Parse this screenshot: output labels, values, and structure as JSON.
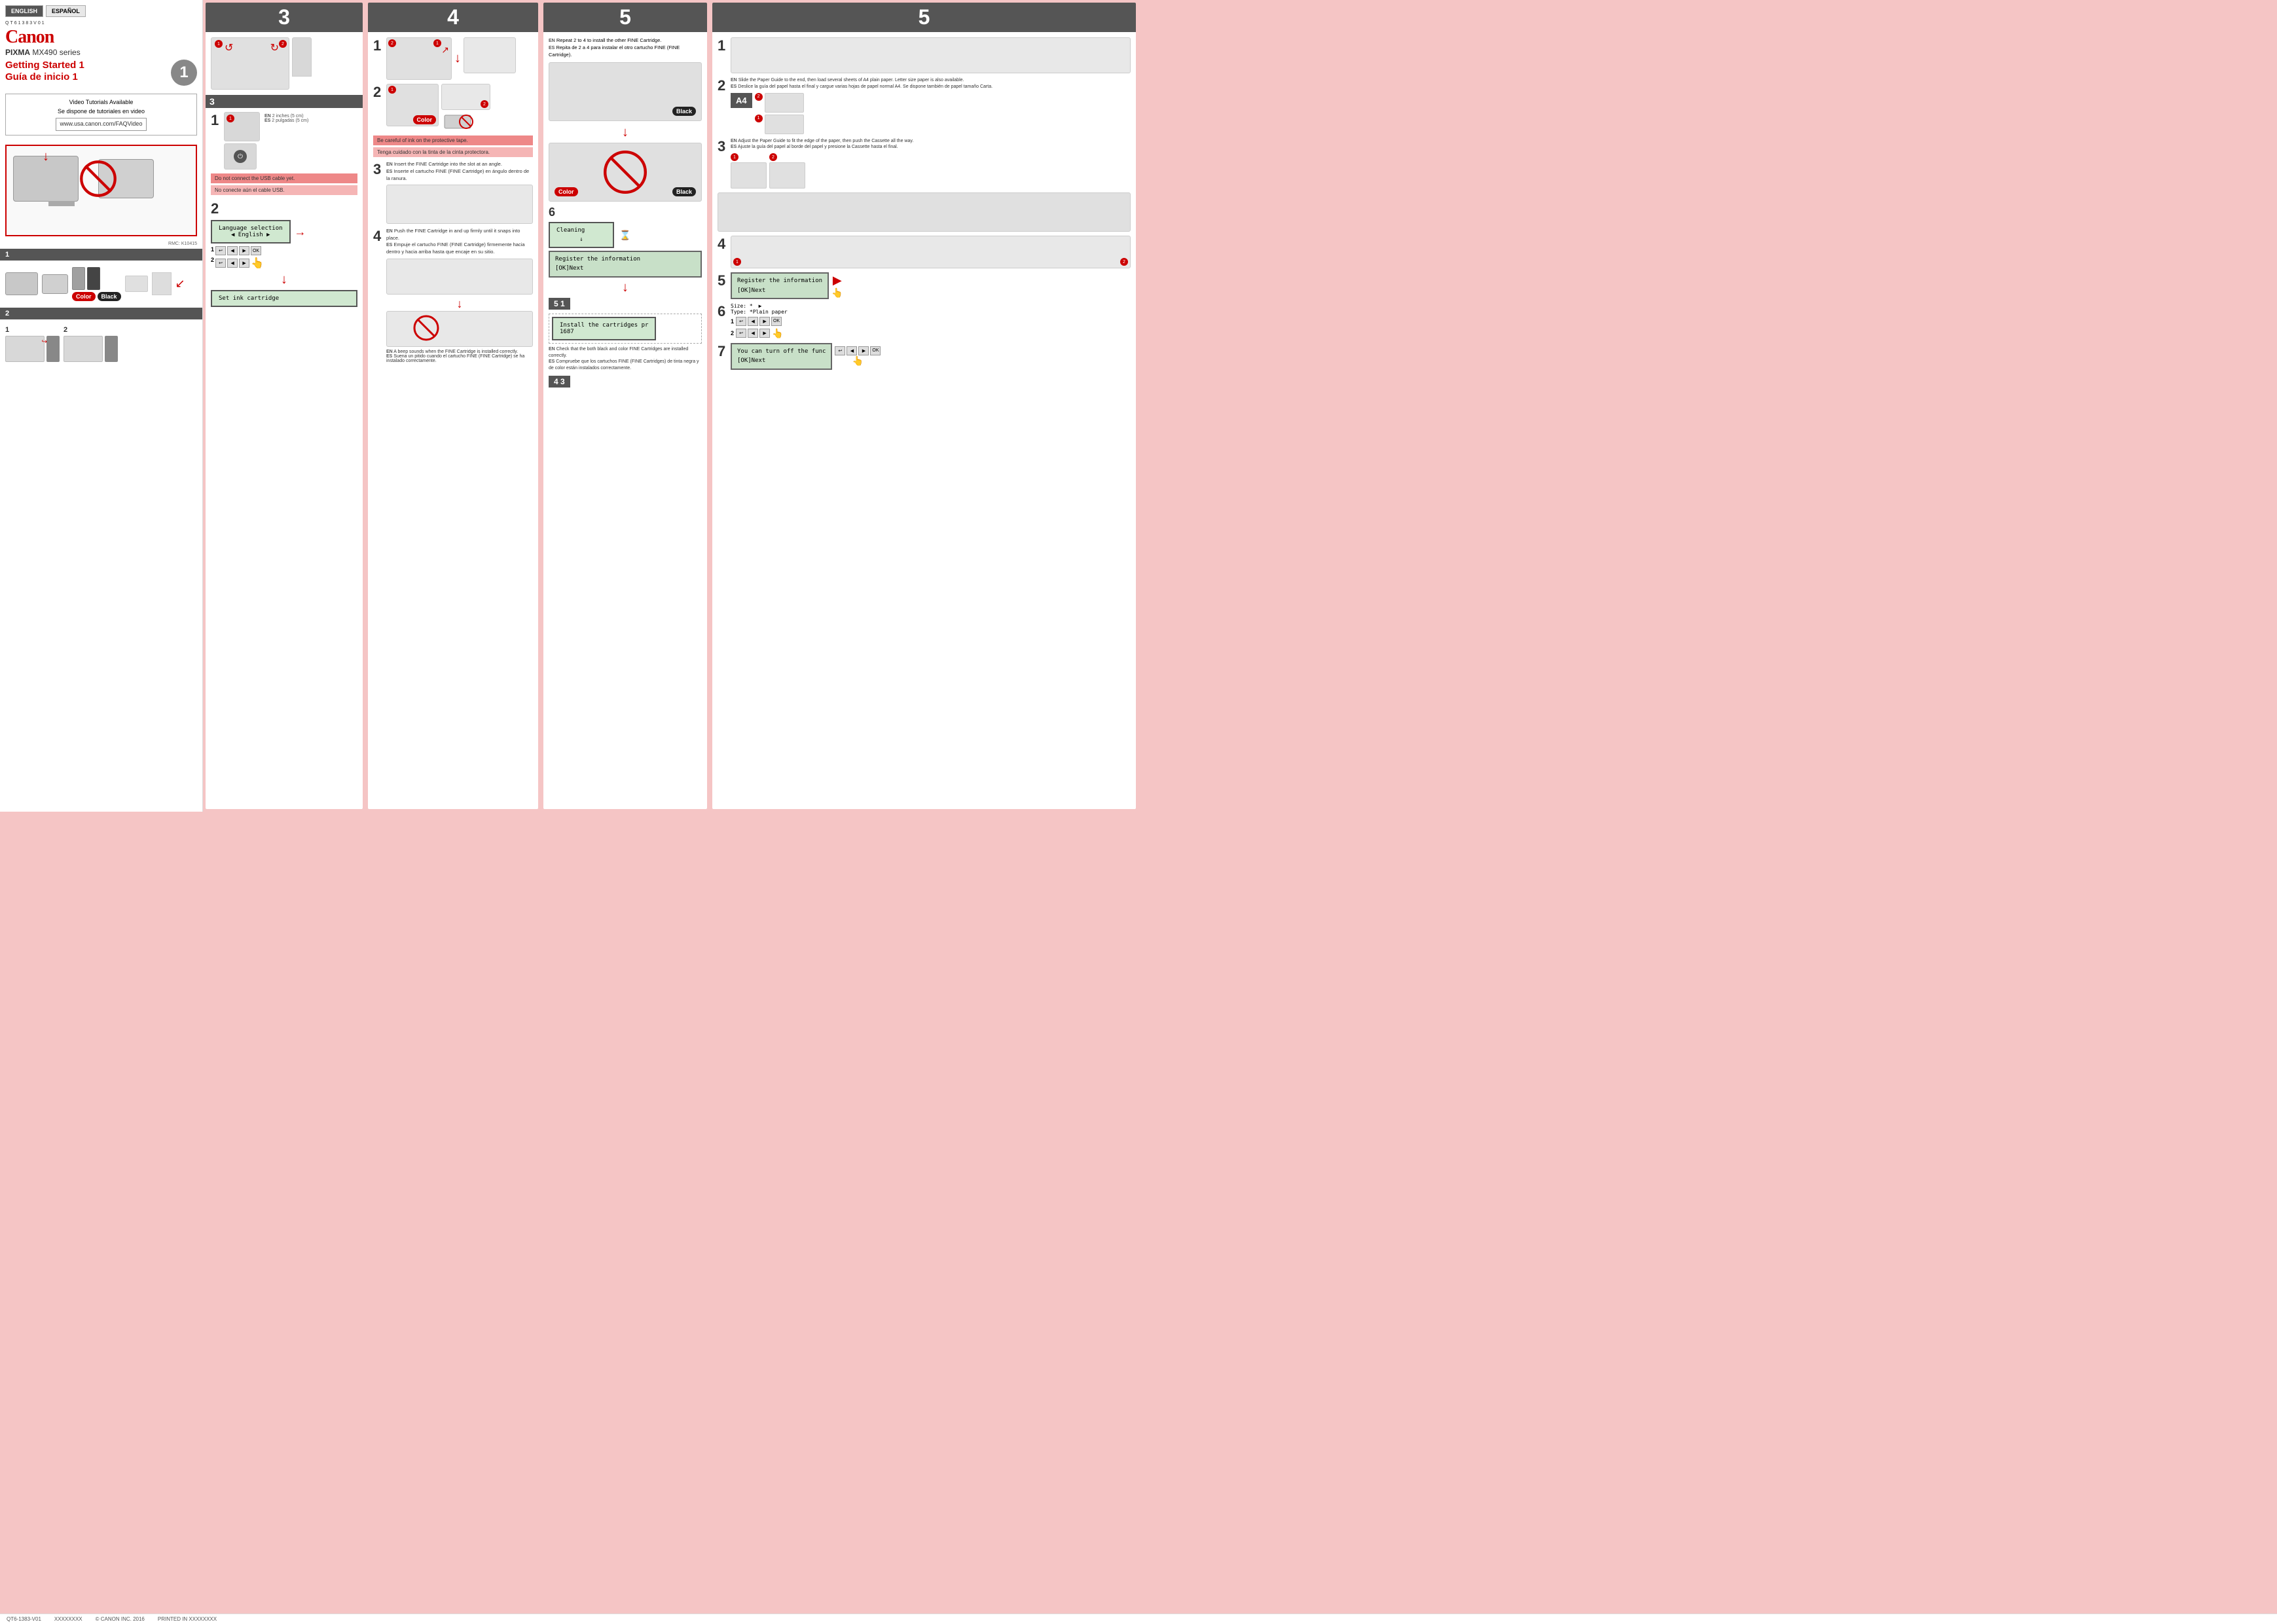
{
  "header": {
    "barcode": "QT61383V01",
    "lang_en": "ENGLISH",
    "lang_es": "ESPAÑOL",
    "canon": "Canon",
    "model": "PIXMA MX490 series",
    "title_en": "Getting Started 1",
    "title_es": "Guía de inicio 1",
    "step_circle": "1"
  },
  "left_panel": {
    "video_title_en": "Video Tutorials Available",
    "video_title_es": "Se dispone de tutoriales en video",
    "video_url": "www.usa.canon.com/FAQVideo",
    "rmc": "RMC: K10415",
    "section1_num": "1",
    "section1_items": [
      {
        "label": "Color",
        "type": "color"
      },
      {
        "label": "Black",
        "type": "black"
      }
    ],
    "section2_num": "2",
    "section2_steps": [
      {
        "num": "1"
      },
      {
        "num": "2"
      }
    ]
  },
  "section3": {
    "header": "3",
    "step3_header": "3",
    "substep1_num": "1",
    "substep1_en": "2 inches (5 cm)",
    "substep1_es": "2 pulgadas (5 cm)",
    "substep2_num": "2",
    "do_not_connect_en": "Do not connect the USB cable yet.",
    "do_not_connect_es": "No conecte aún el cable USB.",
    "lang_select_label": "Language selection",
    "lang_select_value": "English",
    "set_ink_label": "Set ink cartridge",
    "btn1_circle": "1",
    "btn2_circle": "2"
  },
  "section4": {
    "header": "4",
    "substep1_num": "1",
    "substep2_num": "2",
    "substep2_color_label": "Color",
    "warning_en": "Be careful of ink on the protective tape.",
    "warning_es": "Tenga cuidado con la tinta de la cinta protectora.",
    "substep3_num": "3",
    "substep3_en": "Insert the FINE Cartridge into the slot at an angle.",
    "substep3_es": "Inserte el cartucho FINE (FINE Cartridge) en ángulo dentro de la ranura.",
    "substep4_num": "4",
    "substep4_en": "Push the FINE Cartridge in and up firmly until it snaps into place.",
    "substep4_es": "Empuje el cartucho FINE (FINE Cartridge) firmemente hacia dentro y hacia arriba hasta que encaje en su sitio.",
    "beep_en": "A beep sounds when the FINE Cartridge is installed correctly.",
    "beep_es": "Suena un pitido cuando el cartucho FINE (FINE Cartridge) se ha instalado correctamente."
  },
  "section5": {
    "header": "5",
    "top_en": "Repeat 2 to 4 to install the other FINE Cartridge.",
    "top_es": "Repita de 2 a 4 para instalar el otro cartucho FINE (FINE Cartridge).",
    "color_label": "Color",
    "black_label": "Black",
    "substep6_num": "6",
    "cleaning_label": "Cleaning",
    "register_label": "Register the information",
    "ok_next": "[OK]Next",
    "substep5_num": "5",
    "substep5_sub": "1",
    "install_cartridges": "Install the cartridges pr",
    "install_code": "1687",
    "check_en": "Check that the both black and color FINE Cartridges are installed correctly.",
    "check_es": "Compruebe que los cartuchos FINE (FINE Cartridges) de tinta negra y de color están instalados correctamente.",
    "substep4_num": "4",
    "substep4_sub": "3"
  },
  "section5b": {
    "header": "5",
    "substep1_num": "1",
    "substep2_num": "2",
    "substep2_en": "Slide the Paper Guide to the end, then load several sheets of A4 plain paper. Letter size paper is also available.",
    "substep2_es": "Deslice la guía del papel hasta el final y cargue varias hojas de papel normal A4. Se dispone también de papel tamaño Carta.",
    "a4_label": "A4",
    "substep3_num": "3",
    "substep3_en": "Adjust the Paper Guide to fit the edge of the paper, then push the Cassette all the way.",
    "substep3_es": "Ajuste la guía del papel al borde del papel y presione la Cassette hasta el final.",
    "substep4_num": "4",
    "substep5_num": "5",
    "register_label": "Register the information",
    "ok_next": "[OK]Next",
    "substep6_num": "6",
    "size_label": "Size:",
    "size_value": "*",
    "type_label": "Type:",
    "type_value": "*Plain paper",
    "substep7_num": "7",
    "func_label": "You can turn off the func",
    "func_ok": "[OK]Next"
  },
  "footer": {
    "doc_num": "QT6-1383-V01",
    "spacer1": "XXXXXXXX",
    "copyright": "© CANON INC. 2016",
    "printed": "PRINTED IN XXXXXXXX"
  }
}
